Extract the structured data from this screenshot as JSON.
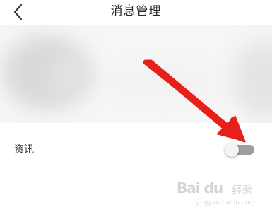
{
  "header": {
    "title": "消息管理",
    "back_icon": "chevron-left-icon"
  },
  "settings": {
    "rows": [
      {
        "label": "资讯",
        "toggle_on": false
      }
    ]
  },
  "colors": {
    "arrow": "#e8201c",
    "toggle_track_off": "#9e9e9e",
    "toggle_knob": "#f4f4f4",
    "title_text": "#2a2a2a"
  },
  "watermark": {
    "brand": "Bai du",
    "word": "经验",
    "url": "jingyan.baidu.com"
  }
}
